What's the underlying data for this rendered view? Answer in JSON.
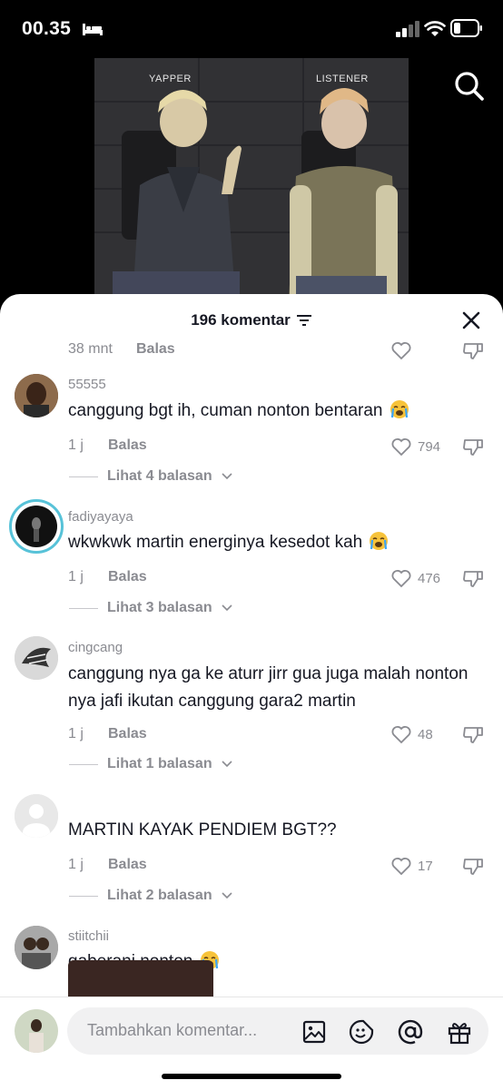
{
  "status": {
    "time": "00.35",
    "icons": [
      "bed-icon",
      "signal-icon",
      "wifi-icon",
      "battery-icon"
    ]
  },
  "video": {
    "label_left": "YAPPER",
    "label_right": "LISTENER"
  },
  "sheet": {
    "title": "196 komentar",
    "prev_comment": {
      "time": "38 mnt",
      "reply": "Balas"
    },
    "comments": [
      {
        "username": "55555",
        "text": "canggung bgt ih, cuman nonton bentaran",
        "emoji": true,
        "time": "1 j",
        "reply": "Balas",
        "likes": "794",
        "view_replies": "Lihat 4 balasan"
      },
      {
        "username": "fadiyayaya",
        "text": "wkwkwk martin energinya kesedot kah",
        "emoji": true,
        "time": "1 j",
        "reply": "Balas",
        "likes": "476",
        "view_replies": "Lihat 3 balasan"
      },
      {
        "username": "cingcang",
        "text": "canggung nya ga ke aturr jirr gua juga malah nonton nya jafi ikutan canggung gara2 martin",
        "emoji": false,
        "time": "1 j",
        "reply": "Balas",
        "likes": "48",
        "view_replies": "Lihat 1 balasan"
      },
      {
        "username": "",
        "text": "MARTIN KAYAK PENDIEM BGT??",
        "emoji": false,
        "time": "1 j",
        "reply": "Balas",
        "likes": "17",
        "view_replies": "Lihat 2 balasan"
      },
      {
        "username": "stiitchii",
        "text": "gaberani nonton",
        "emoji": true
      }
    ]
  },
  "input": {
    "placeholder": "Tambahkan komentar..."
  },
  "colors": {
    "text": "#161823",
    "muted": "#8a8b91",
    "sheet": "#ffffff"
  }
}
